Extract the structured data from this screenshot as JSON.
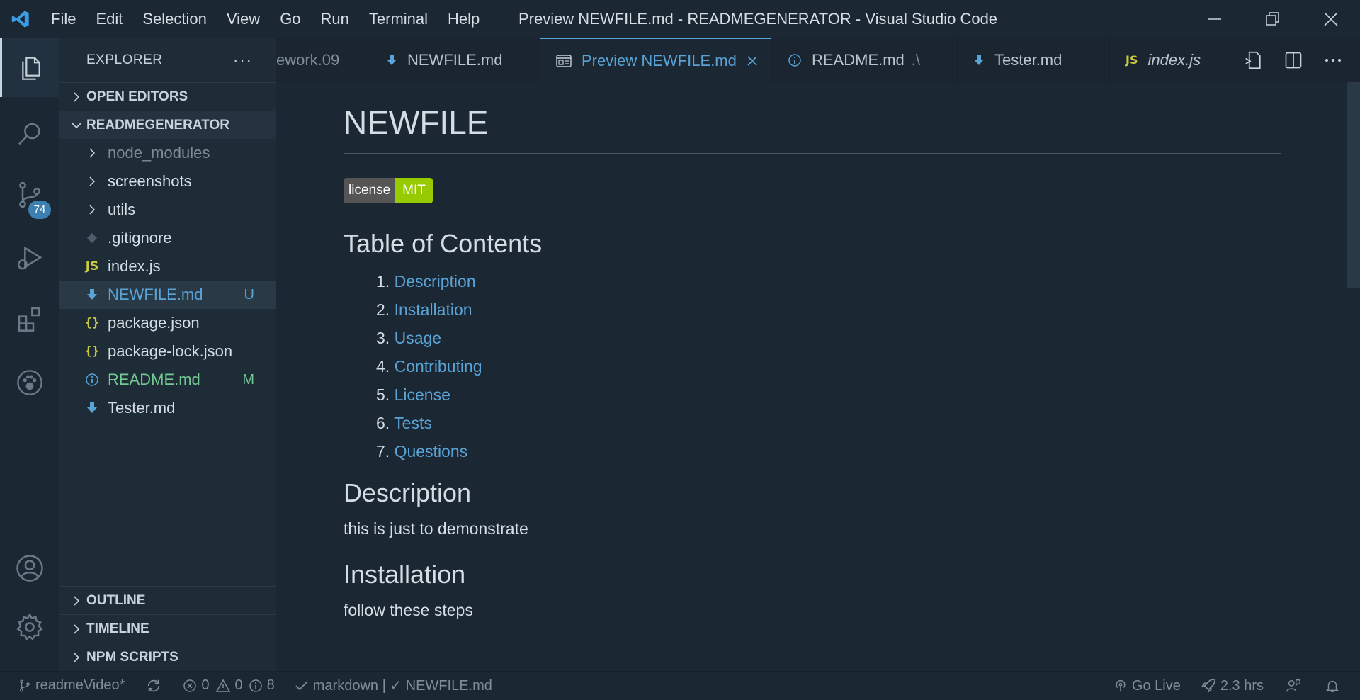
{
  "titlebar": {
    "menu": [
      "File",
      "Edit",
      "Selection",
      "View",
      "Go",
      "Run",
      "Terminal",
      "Help"
    ],
    "title": "Preview NEWFILE.md - READMEGENERATOR - Visual Studio Code"
  },
  "activity": {
    "scm_badge": "74"
  },
  "sidebar": {
    "header": "EXPLORER",
    "open_editors": "OPEN EDITORS",
    "project": "READMEGENERATOR",
    "items": [
      {
        "label": "node_modules",
        "status": ""
      },
      {
        "label": "screenshots",
        "status": ""
      },
      {
        "label": "utils",
        "status": ""
      },
      {
        "label": ".gitignore",
        "status": ""
      },
      {
        "label": "index.js",
        "status": ""
      },
      {
        "label": "NEWFILE.md",
        "status": "U"
      },
      {
        "label": "package.json",
        "status": ""
      },
      {
        "label": "package-lock.json",
        "status": ""
      },
      {
        "label": "README.md",
        "status": "M"
      },
      {
        "label": "Tester.md",
        "status": ""
      }
    ],
    "outline": "OUTLINE",
    "timeline": "TIMELINE",
    "npm_scripts": "NPM SCRIPTS"
  },
  "tabs": [
    {
      "label": "ework.09",
      "suffix": ""
    },
    {
      "label": "NEWFILE.md",
      "suffix": ""
    },
    {
      "label": "Preview NEWFILE.md",
      "suffix": ""
    },
    {
      "label": "README.md",
      "suffix": ".\\"
    },
    {
      "label": "Tester.md",
      "suffix": ""
    },
    {
      "label": "index.js",
      "suffix": ""
    }
  ],
  "preview": {
    "title": "NEWFILE",
    "badge_left": "license",
    "badge_right": "MIT",
    "toc_heading": "Table of Contents",
    "toc": [
      "Description",
      "Installation",
      "Usage",
      "Contributing",
      "License",
      "Tests",
      "Questions"
    ],
    "desc_heading": "Description",
    "desc_text": "this is just to demonstrate",
    "install_heading": "Installation",
    "install_text": "follow these steps"
  },
  "status": {
    "branch": "readmeVideo*",
    "errors": "0",
    "warnings": "0",
    "infos": "8",
    "lint": "markdown | ✓ NEWFILE.md",
    "golive": "Go Live",
    "time": "2.3 hrs"
  },
  "colors": {
    "accent": "#59a3d6",
    "background": "#1b2833",
    "badge_green": "#97ca00",
    "modified": "#73c991"
  }
}
